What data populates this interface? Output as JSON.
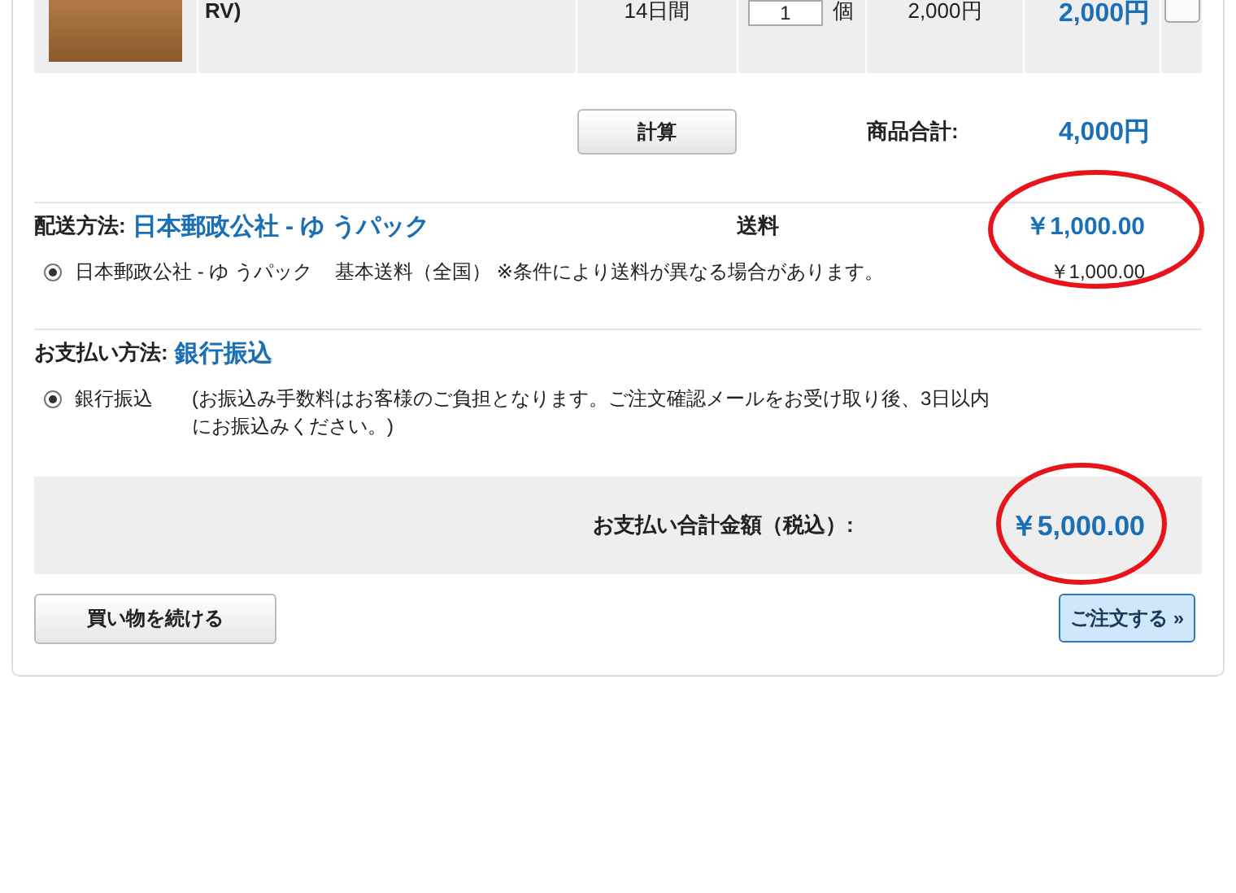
{
  "cart_row": {
    "product_name": "RV)",
    "period": "14日間",
    "quantity": "1",
    "unit": "個",
    "unit_price": "2,000円",
    "subtotal": "2,000円"
  },
  "calc_button": "計算",
  "goods_total": {
    "label": "商品合計:",
    "value": "4,000円"
  },
  "shipping": {
    "label": "配送方法:",
    "method": "日本郵政公社 - ゆ うパック",
    "fee_header": "送料",
    "fee": "￥1,000.00",
    "options": [
      {
        "name": "日本郵政公社 - ゆ うパック",
        "note": "基本送料（全国） ※条件により送料が異なる場合があります。",
        "price": "￥1,000.00",
        "selected": true
      }
    ]
  },
  "payment": {
    "label": "お支払い方法:",
    "method": "銀行振込",
    "options": [
      {
        "name": "銀行振込",
        "note": "(お振込み手数料はお客様のご負担となります。ご注文確認メールをお受け取り後、3日以内にお振込みください。)",
        "selected": true
      }
    ]
  },
  "total": {
    "label": "お支払い合計金額（税込）:",
    "value": "￥5,000.00"
  },
  "buttons": {
    "continue": "買い物を続ける",
    "order": "ご注文する »"
  }
}
